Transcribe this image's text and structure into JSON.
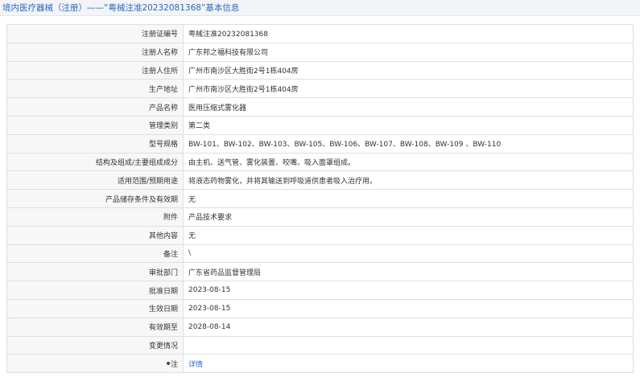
{
  "header": {
    "title": "境内医疗器械（注册）——“粤械注准20232081368”基本信息"
  },
  "rows": [
    {
      "label": "注册证编号",
      "value": "粤械注准20232081368"
    },
    {
      "label": "注册人名称",
      "value": "广东邦之福科技有限公司"
    },
    {
      "label": "注册人住所",
      "value": "广州市南沙区大胜街2号1栋404房"
    },
    {
      "label": "生产地址",
      "value": "广州市南沙区大胜街2号1栋404房"
    },
    {
      "label": "产品名称",
      "value": "医用压缩式雾化器"
    },
    {
      "label": "管理类别",
      "value": "第二类"
    },
    {
      "label": "型号规格",
      "value": "BW-101、BW-102、BW-103、BW-105、BW-106、BW-107、BW-108、BW-109 、BW-110"
    },
    {
      "label": "结构及组成/主要组成成分",
      "value": "由主机、送气管、雾化装置、咬嘴、吸入面罩组成。"
    },
    {
      "label": "适用范围/预期用途",
      "value": "将液态药物雾化，并将其输送到呼吸道供患者吸入治疗用。"
    },
    {
      "label": "产品储存条件及有效期",
      "value": "无"
    },
    {
      "label": "附件",
      "value": "产品技术要求"
    },
    {
      "label": "其他内容",
      "value": "无"
    },
    {
      "label": "备注",
      "value": "\\"
    },
    {
      "label": "审批部门",
      "value": "广东省药品监督管理局"
    },
    {
      "label": "批准日期",
      "value": "2023-08-15"
    },
    {
      "label": "生效日期",
      "value": "2023-08-15"
    },
    {
      "label": "有效期至",
      "value": "2028-08-14"
    },
    {
      "label": "变更情况",
      "value": ""
    },
    {
      "label": "注",
      "value": "详情"
    }
  ]
}
